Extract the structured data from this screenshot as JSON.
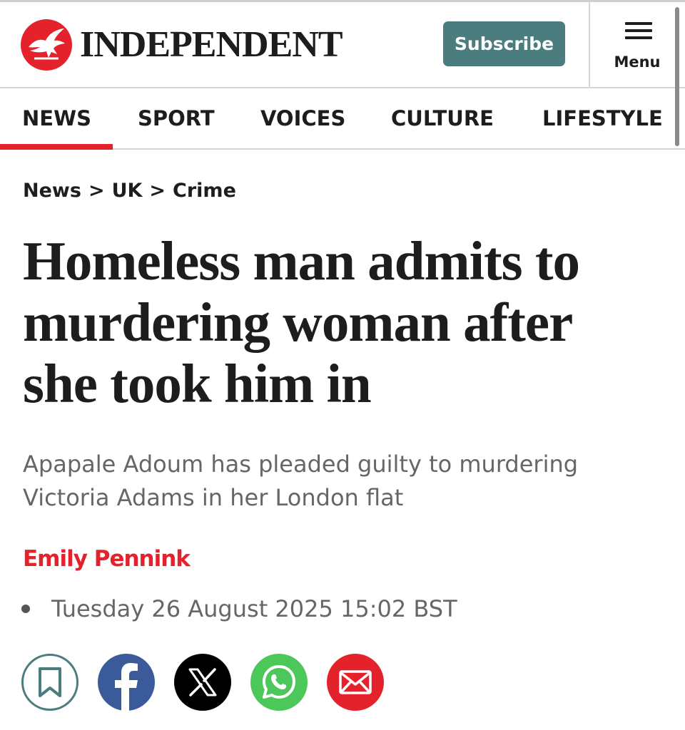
{
  "header": {
    "logo_text": "INDEPENDENT",
    "subscribe_label": "Subscribe",
    "menu_label": "Menu"
  },
  "nav": {
    "items": [
      {
        "label": "NEWS",
        "active": true
      },
      {
        "label": "SPORT"
      },
      {
        "label": "VOICES"
      },
      {
        "label": "CULTURE"
      },
      {
        "label": "LIFESTYLE"
      }
    ]
  },
  "breadcrumb": {
    "items": [
      "News",
      "UK",
      "Crime"
    ],
    "separator": ">"
  },
  "article": {
    "headline_lines": [
      "Homeless man admits to",
      "murdering woman after",
      "she took him in"
    ],
    "standfirst_lines": [
      "Apapale Adoum has pleaded guilty to murdering",
      "Victoria Adams in her London flat"
    ],
    "author": "Emily Pennink",
    "date": "Tuesday 26 August 2025 15:02 BST"
  },
  "share": [
    {
      "icon": "bookmark-icon",
      "color": "#4b7c7e"
    },
    {
      "icon": "facebook-icon",
      "color": "#3b5a9a"
    },
    {
      "icon": "x-icon",
      "color": "#000000"
    },
    {
      "icon": "whatsapp-icon",
      "color": "#4cc85a"
    },
    {
      "icon": "email-icon",
      "color": "#e4222b"
    }
  ],
  "colors": {
    "brand_red": "#e4222b",
    "subscribe_teal": "#4b7c7e",
    "text": "#1d1d1b",
    "muted": "#666666"
  }
}
